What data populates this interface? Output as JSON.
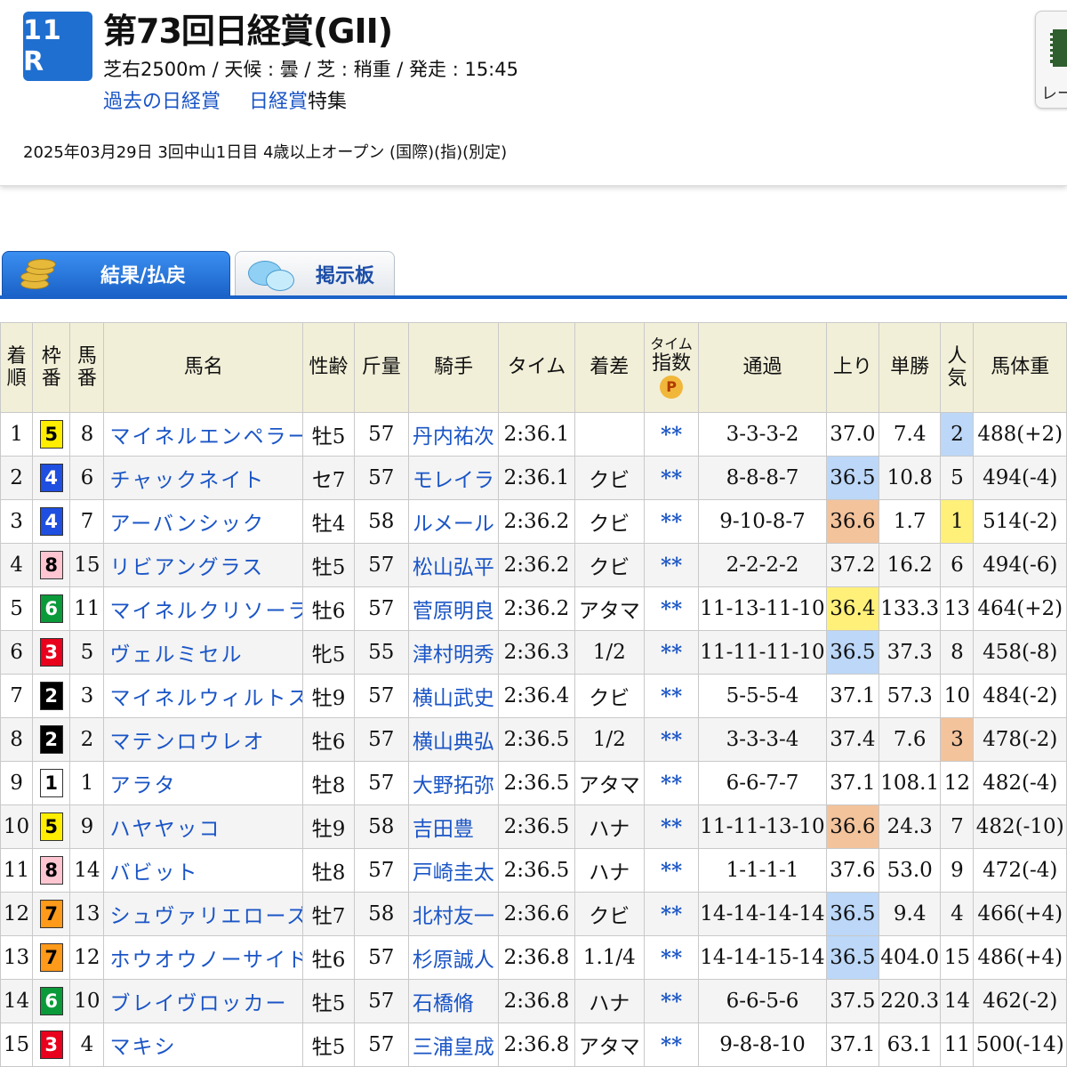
{
  "header": {
    "race_number": "11 R",
    "race_name": "第73回日経賞(GII)",
    "conditions": "芝右2500m /  天候 : 曇 /  芝 : 稍重  /  発走 : 15:45",
    "link_past": "過去の日経賞",
    "link_feature_a": "日経賞",
    "link_feature_b": "特集",
    "date_info": "2025年03月29日 3回中山1日目 4歳以上オープン  (国際)(指)(別定)",
    "side_button_label": "レー"
  },
  "tabs": {
    "result": "結果/払戻",
    "board": "掲示板"
  },
  "colors": {
    "waku": {
      "1": {
        "bg": "#ffffff",
        "fg": "#000000"
      },
      "2": {
        "bg": "#000000",
        "fg": "#ffffff"
      },
      "3": {
        "bg": "#e8001c",
        "fg": "#ffffff"
      },
      "4": {
        "bg": "#1f4fe0",
        "fg": "#ffffff"
      },
      "5": {
        "bg": "#ffee00",
        "fg": "#000000"
      },
      "6": {
        "bg": "#0a9a3a",
        "fg": "#ffffff"
      },
      "7": {
        "bg": "#ff9a1a",
        "fg": "#000000"
      },
      "8": {
        "bg": "#ffc6d2",
        "fg": "#000000"
      }
    },
    "rank_1": "#fff07a",
    "rank_2": "#bcd7f7",
    "rank_3": "#f3c39c"
  },
  "columns": {
    "finish": "着\n順",
    "waku": "枠\n番",
    "number": "馬\n番",
    "horse": "馬名",
    "sex_age": "性齢",
    "weight": "斤量",
    "jockey": "騎手",
    "time": "タイム",
    "margin": "着差",
    "index_top": "タイム",
    "index_bottom": "指数",
    "index_badge": "P",
    "passing": "通過",
    "last3f": "上り",
    "odds": "単勝",
    "popularity": "人\n気",
    "body_weight": "馬体重"
  },
  "rows": [
    {
      "finish": "1",
      "waku": "5",
      "number": "8",
      "horse": "マイネルエンペラー",
      "sex_age": "牡5",
      "weight": "57",
      "jockey": "丹内祐次",
      "time": "2:36.1",
      "margin": "",
      "index": "**",
      "passing": "3-3-3-2",
      "last3f": "37.0",
      "last3f_rank": 0,
      "odds": "7.4",
      "pop": "2",
      "pop_rank": 2,
      "body": "488(+2)"
    },
    {
      "finish": "2",
      "waku": "4",
      "number": "6",
      "horse": "チャックネイト",
      "sex_age": "セ7",
      "weight": "57",
      "jockey": "モレイラ",
      "time": "2:36.1",
      "margin": "クビ",
      "index": "**",
      "passing": "8-8-8-7",
      "last3f": "36.5",
      "last3f_rank": 2,
      "odds": "10.8",
      "pop": "5",
      "pop_rank": 0,
      "body": "494(-4)"
    },
    {
      "finish": "3",
      "waku": "4",
      "number": "7",
      "horse": "アーバンシック",
      "sex_age": "牡4",
      "weight": "58",
      "jockey": "ルメール",
      "time": "2:36.2",
      "margin": "クビ",
      "index": "**",
      "passing": "9-10-8-7",
      "last3f": "36.6",
      "last3f_rank": 3,
      "odds": "1.7",
      "pop": "1",
      "pop_rank": 1,
      "body": "514(-2)"
    },
    {
      "finish": "4",
      "waku": "8",
      "number": "15",
      "horse": "リビアングラス",
      "sex_age": "牡5",
      "weight": "57",
      "jockey": "松山弘平",
      "time": "2:36.2",
      "margin": "クビ",
      "index": "**",
      "passing": "2-2-2-2",
      "last3f": "37.2",
      "last3f_rank": 0,
      "odds": "16.2",
      "pop": "6",
      "pop_rank": 0,
      "body": "494(-6)"
    },
    {
      "finish": "5",
      "waku": "6",
      "number": "11",
      "horse": "マイネルクリソーラ",
      "sex_age": "牡6",
      "weight": "57",
      "jockey": "菅原明良",
      "time": "2:36.2",
      "margin": "アタマ",
      "index": "**",
      "passing": "11-13-11-10",
      "last3f": "36.4",
      "last3f_rank": 1,
      "odds": "133.3",
      "pop": "13",
      "pop_rank": 0,
      "body": "464(+2)"
    },
    {
      "finish": "6",
      "waku": "3",
      "number": "5",
      "horse": "ヴェルミセル",
      "sex_age": "牝5",
      "weight": "55",
      "jockey": "津村明秀",
      "time": "2:36.3",
      "margin": "1/2",
      "index": "**",
      "passing": "11-11-11-10",
      "last3f": "36.5",
      "last3f_rank": 2,
      "odds": "37.3",
      "pop": "8",
      "pop_rank": 0,
      "body": "458(-8)"
    },
    {
      "finish": "7",
      "waku": "2",
      "number": "3",
      "horse": "マイネルウィルトス",
      "sex_age": "牡9",
      "weight": "57",
      "jockey": "横山武史",
      "time": "2:36.4",
      "margin": "クビ",
      "index": "**",
      "passing": "5-5-5-4",
      "last3f": "37.1",
      "last3f_rank": 0,
      "odds": "57.3",
      "pop": "10",
      "pop_rank": 0,
      "body": "484(-2)"
    },
    {
      "finish": "8",
      "waku": "2",
      "number": "2",
      "horse": "マテンロウレオ",
      "sex_age": "牡6",
      "weight": "57",
      "jockey": "横山典弘",
      "time": "2:36.5",
      "margin": "1/2",
      "index": "**",
      "passing": "3-3-3-4",
      "last3f": "37.4",
      "last3f_rank": 0,
      "odds": "7.6",
      "pop": "3",
      "pop_rank": 3,
      "body": "478(-2)"
    },
    {
      "finish": "9",
      "waku": "1",
      "number": "1",
      "horse": "アラタ",
      "sex_age": "牡8",
      "weight": "57",
      "jockey": "大野拓弥",
      "time": "2:36.5",
      "margin": "アタマ",
      "index": "**",
      "passing": "6-6-7-7",
      "last3f": "37.1",
      "last3f_rank": 0,
      "odds": "108.1",
      "pop": "12",
      "pop_rank": 0,
      "body": "482(-4)"
    },
    {
      "finish": "10",
      "waku": "5",
      "number": "9",
      "horse": "ハヤヤッコ",
      "sex_age": "牡9",
      "weight": "58",
      "jockey": "吉田豊",
      "time": "2:36.5",
      "margin": "ハナ",
      "index": "**",
      "passing": "11-11-13-10",
      "last3f": "36.6",
      "last3f_rank": 3,
      "odds": "24.3",
      "pop": "7",
      "pop_rank": 0,
      "body": "482(-10)"
    },
    {
      "finish": "11",
      "waku": "8",
      "number": "14",
      "horse": "バビット",
      "sex_age": "牡8",
      "weight": "57",
      "jockey": "戸崎圭太",
      "time": "2:36.5",
      "margin": "ハナ",
      "index": "**",
      "passing": "1-1-1-1",
      "last3f": "37.6",
      "last3f_rank": 0,
      "odds": "53.0",
      "pop": "9",
      "pop_rank": 0,
      "body": "472(-4)"
    },
    {
      "finish": "12",
      "waku": "7",
      "number": "13",
      "horse": "シュヴァリエローズ",
      "sex_age": "牡7",
      "weight": "58",
      "jockey": "北村友一",
      "time": "2:36.6",
      "margin": "クビ",
      "index": "**",
      "passing": "14-14-14-14",
      "last3f": "36.5",
      "last3f_rank": 2,
      "odds": "9.4",
      "pop": "4",
      "pop_rank": 0,
      "body": "466(+4)"
    },
    {
      "finish": "13",
      "waku": "7",
      "number": "12",
      "horse": "ホウオウノーサイド",
      "sex_age": "牡6",
      "weight": "57",
      "jockey": "杉原誠人",
      "time": "2:36.8",
      "margin": "1.1/4",
      "index": "**",
      "passing": "14-14-15-14",
      "last3f": "36.5",
      "last3f_rank": 2,
      "odds": "404.0",
      "pop": "15",
      "pop_rank": 0,
      "body": "486(+4)"
    },
    {
      "finish": "14",
      "waku": "6",
      "number": "10",
      "horse": "ブレイヴロッカー",
      "sex_age": "牡5",
      "weight": "57",
      "jockey": "石橋脩",
      "time": "2:36.8",
      "margin": "ハナ",
      "index": "**",
      "passing": "6-6-5-6",
      "last3f": "37.5",
      "last3f_rank": 0,
      "odds": "220.3",
      "pop": "14",
      "pop_rank": 0,
      "body": "462(-2)"
    },
    {
      "finish": "15",
      "waku": "3",
      "number": "4",
      "horse": "マキシ",
      "sex_age": "牡5",
      "weight": "57",
      "jockey": "三浦皇成",
      "time": "2:36.8",
      "margin": "アタマ",
      "index": "**",
      "passing": "9-8-8-10",
      "last3f": "37.1",
      "last3f_rank": 0,
      "odds": "63.1",
      "pop": "11",
      "pop_rank": 0,
      "body": "500(-14)"
    }
  ]
}
